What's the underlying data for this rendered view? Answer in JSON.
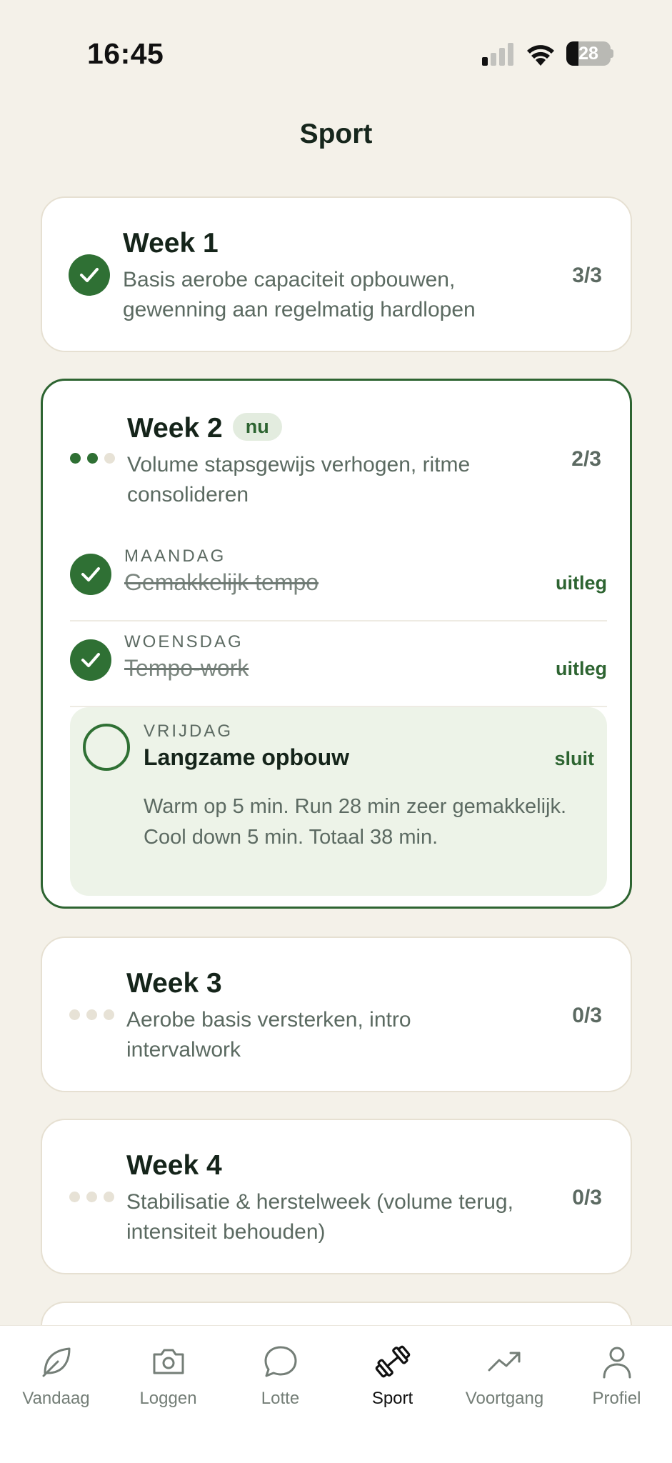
{
  "status_bar": {
    "time": "16:45",
    "battery": "28",
    "battery_level": 0.28
  },
  "header": {
    "title": "Sport"
  },
  "weeks": [
    {
      "title": "Week 1",
      "description": "Basis aerobe capaciteit opbouwen, gewenning aan regelmatig hardlopen",
      "count": "3/3",
      "status": "completed"
    },
    {
      "title": "Week 2",
      "badge": "nu",
      "description": "Volume stapsgewijs verhogen, ritme consolideren",
      "count": "2/3",
      "status": "current",
      "sessions": [
        {
          "day": "MAANDAG",
          "name": "Gemakkelijk tempo",
          "action": "uitleg",
          "done": true
        },
        {
          "day": "WOENSDAG",
          "name": "Tempo-work",
          "action": "uitleg",
          "done": true
        },
        {
          "day": "VRIJDAG",
          "name": "Langzame opbouw",
          "action": "sluit",
          "done": false,
          "detail": "Warm op 5 min. Run 28 min zeer gemakkelijk. Cool down 5 min. Totaal 38 min."
        }
      ]
    },
    {
      "title": "Week 3",
      "description": "Aerobe basis versterken, intro intervalwork",
      "count": "0/3",
      "status": "upcoming"
    },
    {
      "title": "Week 4",
      "description": "Stabilisatie & herstelweek (volume terug, intensiteit behouden)",
      "count": "0/3",
      "status": "upcoming"
    }
  ],
  "tabs": [
    {
      "label": "Vandaag",
      "icon": "leaf-icon"
    },
    {
      "label": "Loggen",
      "icon": "camera-icon"
    },
    {
      "label": "Lotte",
      "icon": "chat-bubble-icon"
    },
    {
      "label": "Sport",
      "icon": "dumbbell-icon",
      "active": true
    },
    {
      "label": "Voortgang",
      "icon": "trend-up-icon"
    },
    {
      "label": "Profiel",
      "icon": "person-icon"
    }
  ],
  "colors": {
    "background": "#f4f1e9",
    "accent": "#2f7034",
    "accent_soft": "#edf3e8",
    "card": "#ffffff",
    "text_muted": "#5c6a62"
  }
}
